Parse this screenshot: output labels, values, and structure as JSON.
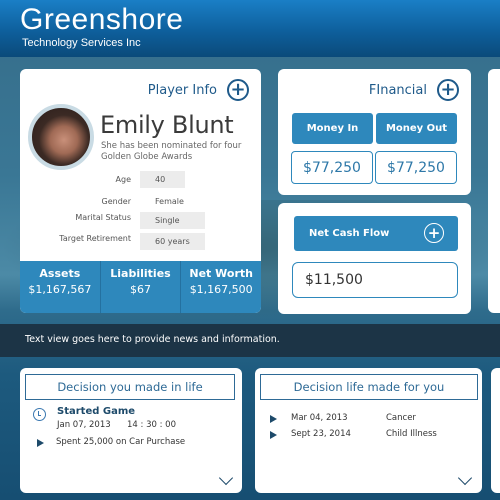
{
  "header": {
    "title": "Greenshore",
    "subtitle": "Technology Services Inc"
  },
  "player": {
    "section_title": "Player Info",
    "name": "Emily Blunt",
    "bio": "She has been nominated for four Golden Globe Awards",
    "attributes": [
      {
        "label": "Age",
        "value": "40"
      },
      {
        "label": "Gender",
        "value": "Female"
      },
      {
        "label": "Marital Status",
        "value": "Single"
      },
      {
        "label": "Target Retirement",
        "value": "60 years"
      }
    ],
    "stats": [
      {
        "label": "Assets",
        "value": "$1,167,567"
      },
      {
        "label": "Liabilities",
        "value": "$67"
      },
      {
        "label": "Net Worth",
        "value": "$1,167,500"
      }
    ]
  },
  "financial": {
    "section_title": "FInancial",
    "money_in_label": "Money In",
    "money_out_label": "Money Out",
    "money_in_value": "$77,250",
    "money_out_value": "$77,250"
  },
  "net_cash_flow": {
    "label": "Net Cash Flow",
    "value": "$11,500"
  },
  "news": {
    "text": "Text view goes here to provide news and information."
  },
  "decisions_made": {
    "title": "Decision you made in life",
    "event_title": "Started Game",
    "event_date": "Jan 07, 2013",
    "event_time": "14 : 30 : 00",
    "items": [
      {
        "text": "Spent 25,000 on Car Purchase"
      }
    ]
  },
  "decisions_life": {
    "title": "Decision life made for you",
    "items": [
      {
        "date": "Mar 04, 2013",
        "event": "Cancer"
      },
      {
        "date": "Sept 23, 2014",
        "event": "Child Illness"
      }
    ]
  },
  "colors": {
    "accent": "#2e88bc",
    "header": "#0e5f9c",
    "news_bar": "#1c3446"
  }
}
